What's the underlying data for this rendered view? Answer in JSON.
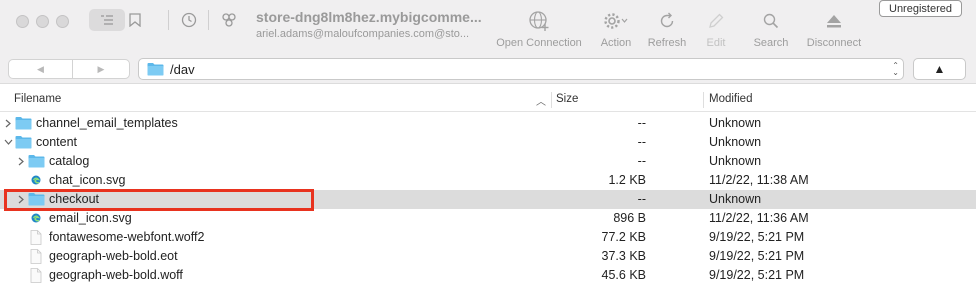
{
  "window": {
    "host": "store-dng8lm8hez.mybigcomme...",
    "user": "ariel.adams@maloufcompanies.com@sto...",
    "unregistered_label": "Unregistered"
  },
  "toolbar": {
    "actions": [
      {
        "label": "Open Connection",
        "icon": "globe-plus-icon"
      },
      {
        "label": "Action",
        "icon": "gear-icon"
      },
      {
        "label": "Refresh",
        "icon": "refresh-icon"
      },
      {
        "label": "Edit",
        "icon": "pencil-icon"
      },
      {
        "label": "Search",
        "icon": "search-icon"
      },
      {
        "label": "Disconnect",
        "icon": "eject-icon"
      }
    ]
  },
  "pathbar": {
    "path": "/dav",
    "back_glyph": "◀",
    "forward_glyph": "▶",
    "up_glyph": "▲"
  },
  "table": {
    "headers": {
      "filename": "Filename",
      "size": "Size",
      "modified": "Modified"
    },
    "rows": [
      {
        "name": "channel_email_templates",
        "size": "--",
        "modified": "Unknown",
        "kind": "folder",
        "depth": 0,
        "expanded": false
      },
      {
        "name": "content",
        "size": "--",
        "modified": "Unknown",
        "kind": "folder",
        "depth": 0,
        "expanded": true
      },
      {
        "name": "catalog",
        "size": "--",
        "modified": "Unknown",
        "kind": "folder",
        "depth": 1,
        "expanded": false
      },
      {
        "name": "chat_icon.svg",
        "size": "1.2 KB",
        "modified": "11/2/22, 11:38 AM",
        "kind": "svg",
        "depth": 1
      },
      {
        "name": "checkout",
        "size": "--",
        "modified": "Unknown",
        "kind": "folder",
        "depth": 1,
        "expanded": false,
        "selected": true
      },
      {
        "name": "email_icon.svg",
        "size": "896 B",
        "modified": "11/2/22, 11:36 AM",
        "kind": "svg",
        "depth": 1
      },
      {
        "name": "fontawesome-webfont.woff2",
        "size": "77.2 KB",
        "modified": "9/19/22, 5:21 PM",
        "kind": "file",
        "depth": 1
      },
      {
        "name": "geograph-web-bold.eot",
        "size": "37.3 KB",
        "modified": "9/19/22, 5:21 PM",
        "kind": "file",
        "depth": 1
      },
      {
        "name": "geograph-web-bold.woff",
        "size": "45.6 KB",
        "modified": "9/19/22, 5:21 PM",
        "kind": "file",
        "depth": 1
      }
    ]
  },
  "colors": {
    "folder": "#5cb8ea",
    "highlight_box": "#e8331f",
    "selected_row": "#dcdcdc"
  }
}
